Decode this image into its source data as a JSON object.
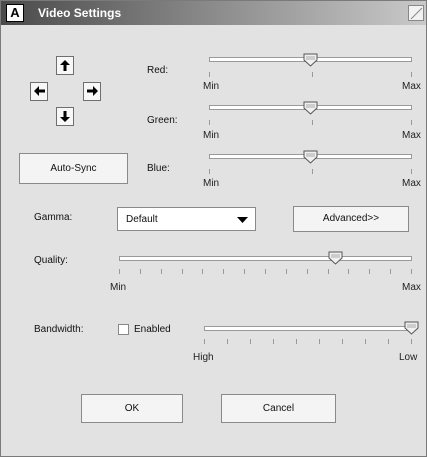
{
  "window": {
    "title": "Video Settings",
    "logo_text": "A"
  },
  "arrows": {
    "up": "up-arrow",
    "left": "left-arrow",
    "right": "right-arrow",
    "down": "down-arrow"
  },
  "auto_sync_label": "Auto-Sync",
  "color_sliders": [
    {
      "label": "Red:",
      "min_label": "Min",
      "max_label": "Max",
      "value": 0.5
    },
    {
      "label": "Green:",
      "min_label": "Min",
      "max_label": "Max",
      "value": 0.5
    },
    {
      "label": "Blue:",
      "min_label": "Min",
      "max_label": "Max",
      "value": 0.5
    }
  ],
  "gamma": {
    "label": "Gamma:",
    "selected": "Default"
  },
  "advanced_label": "Advanced>>",
  "quality": {
    "label": "Quality:",
    "min_label": "Min",
    "max_label": "Max",
    "value": 0.74
  },
  "bandwidth": {
    "label": "Bandwidth:",
    "checkbox_label": "Enabled",
    "checked": false,
    "left_label": "High",
    "right_label": "Low",
    "value": 1.0
  },
  "ok_label": "OK",
  "cancel_label": "Cancel"
}
